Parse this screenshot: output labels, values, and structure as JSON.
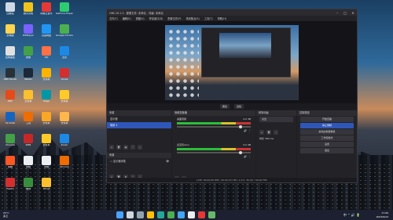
{
  "desktop": {
    "icons": [
      {
        "label": "回收站",
        "color": "#cfd8e3",
        "col": 0,
        "row": 0
      },
      {
        "label": "腾讯文档",
        "color": "#f0c419",
        "col": 1,
        "row": 0
      },
      {
        "label": "网易云音乐",
        "color": "#e53935",
        "col": 2,
        "row": 0
      },
      {
        "label": "GeForce Experience",
        "color": "#2ecc71",
        "col": 3,
        "row": 0
      },
      {
        "label": "此电脑",
        "color": "#ffd54f",
        "col": 0,
        "row": 1
      },
      {
        "label": "PotPlayer",
        "color": "#7b61ff",
        "col": 1,
        "row": 1
      },
      {
        "label": "百度网盘",
        "color": "#2196f3",
        "col": 2,
        "row": 1
      },
      {
        "label": "Google Chrome",
        "color": "#4caf50",
        "col": 3,
        "row": 1
      },
      {
        "label": "控制面板",
        "color": "#e0e0e0",
        "col": 0,
        "row": 2
      },
      {
        "label": "微信",
        "color": "#43a047",
        "col": 1,
        "row": 2
      },
      {
        "label": "QQ",
        "color": "#ff7043",
        "col": 2,
        "row": 2
      },
      {
        "label": "迅雷",
        "color": "#1e88e5",
        "col": 3,
        "row": 2
      },
      {
        "label": "OBS Studio",
        "color": "#263238",
        "col": 0,
        "row": 3
      },
      {
        "label": "Steam",
        "color": "#1b2838",
        "col": 1,
        "row": 3
      },
      {
        "label": "文件夹",
        "color": "#ffb300",
        "col": 2,
        "row": 3
      },
      {
        "label": "Gmail",
        "color": "#d32f2f",
        "col": 3,
        "row": 3
      },
      {
        "label": "PDF",
        "color": "#e64a19",
        "col": 0,
        "row": 4
      },
      {
        "label": "文件夹",
        "color": "#fbc02d",
        "col": 1,
        "row": 4
      },
      {
        "label": "Edge",
        "color": "#0097a7",
        "col": 2,
        "row": 4
      },
      {
        "label": "文件夹",
        "color": "#ffca28",
        "col": 3,
        "row": 4
      },
      {
        "label": "Vs Code",
        "color": "#1565c0",
        "col": 0,
        "row": 5
      },
      {
        "label": "工具",
        "color": "#ef6c00",
        "col": 1,
        "row": 5
      },
      {
        "label": "文件夹",
        "color": "#f9a825",
        "col": 2,
        "row": 5
      },
      {
        "label": "文件夹",
        "color": "#ffb74d",
        "col": 3,
        "row": 5
      },
      {
        "label": "Chrome",
        "color": "#43a047",
        "col": 0,
        "row": 6
      },
      {
        "label": "WPS",
        "color": "#c62828",
        "col": 1,
        "row": 6
      },
      {
        "label": "文件夹",
        "color": "#ffca28",
        "col": 2,
        "row": 6
      },
      {
        "label": "Zoom",
        "color": "#1e88e5",
        "col": 3,
        "row": 6
      },
      {
        "label": "剪映",
        "color": "#ff5722",
        "col": 0,
        "row": 7
      },
      {
        "label": "文档",
        "color": "#eceff1",
        "col": 1,
        "row": 7
      },
      {
        "label": "文档",
        "color": "#eceff1",
        "col": 2,
        "row": 7
      },
      {
        "label": "Chrome",
        "color": "#ef6c00",
        "col": 3,
        "row": 7
      },
      {
        "label": "Opera",
        "color": "#d32f2f",
        "col": 0,
        "row": 8
      },
      {
        "label": "游戏",
        "color": "#388e3c",
        "col": 1,
        "row": 8
      },
      {
        "label": "Drive",
        "color": "#fbc02d",
        "col": 2,
        "row": 8
      }
    ]
  },
  "obs": {
    "title": "OBS 29.1.3 - 配置文件: 未命名 - 场景: 未命名",
    "menu": [
      "文件(F)",
      "编辑(E)",
      "视图(V)",
      "停靠窗口(D)",
      "配置文件(P)",
      "场景集合(S)",
      "工具(T)",
      "帮助(H)"
    ],
    "controls_bar": {
      "properties": "属性",
      "filters": "滤镜"
    },
    "docks": {
      "scenes": {
        "title": "来源",
        "items": [
          "显示器",
          "场景 2"
        ],
        "selected": 1
      },
      "sources": {
        "title": "来源",
        "items": [
          "显示器采集"
        ]
      },
      "mixer": {
        "title": "音频混音器",
        "channels": [
          {
            "name": "桌面音频",
            "db": "0.0 dB",
            "level": 0.86
          },
          {
            "name": "麦克风/Aux",
            "db": "0.0 dB",
            "level": 0.86
          }
        ]
      },
      "transitions": {
        "title": "转场动画",
        "value": "淡出",
        "duration_label": "时长",
        "duration": "300 ms"
      },
      "controls": {
        "title": "控制按钮",
        "buttons": [
          {
            "label": "开始直播",
            "primary": false
          },
          {
            "label": "停止录制",
            "primary": true
          },
          {
            "label": "启动虚拟摄像机",
            "primary": false
          },
          {
            "label": "工作室模式",
            "primary": false
          },
          {
            "label": "设置",
            "primary": false
          },
          {
            "label": "退出",
            "primary": false
          }
        ]
      }
    },
    "status": "LIVE: 00:00:00   REC: 00:00:15   CPU: 2.1%, 30.00 / 30.00 FPS"
  },
  "taskbar": {
    "weather_temp": "25°C",
    "weather_desc": "多云",
    "time": "17:06",
    "date": "2023/9/24",
    "tray": "中  ⌃ 🔊 🔋",
    "apps": [
      {
        "name": "start",
        "color": "#4aa3ff"
      },
      {
        "name": "search",
        "color": "#cfd8dc"
      },
      {
        "name": "task-view",
        "color": "#90a4ae"
      },
      {
        "name": "file-explorer",
        "color": "#ffc107"
      },
      {
        "name": "edge",
        "color": "#26a69a"
      },
      {
        "name": "chrome",
        "color": "#4caf50"
      },
      {
        "name": "store",
        "color": "#42a5f5"
      },
      {
        "name": "obs",
        "color": "#eceff1"
      },
      {
        "name": "netease",
        "color": "#e53935"
      },
      {
        "name": "wechat",
        "color": "#66bb6a"
      }
    ]
  }
}
